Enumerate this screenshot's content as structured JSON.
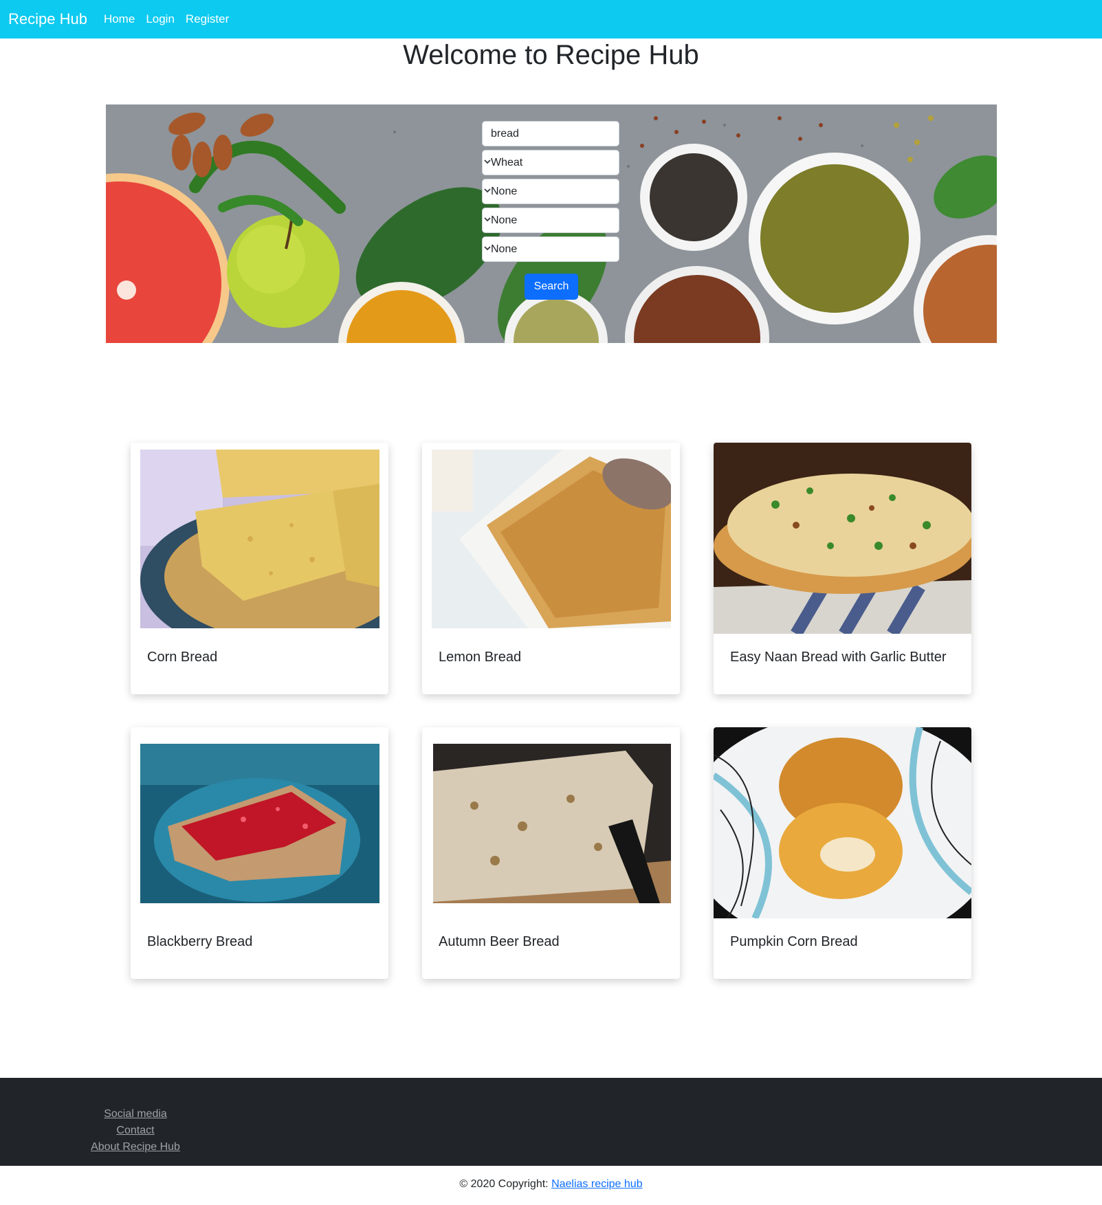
{
  "navbar": {
    "brand": "Recipe Hub",
    "links": [
      "Home",
      "Login",
      "Register"
    ]
  },
  "page_title": "Welcome to Recipe Hub",
  "search": {
    "query_value": "bread",
    "selects": [
      "Wheat",
      "None",
      "None",
      "None"
    ],
    "button_label": "Search"
  },
  "recipes": [
    {
      "title": "Corn Bread"
    },
    {
      "title": "Lemon Bread"
    },
    {
      "title": "Easy Naan Bread with Garlic Butter"
    },
    {
      "title": "Blackberry Bread"
    },
    {
      "title": "Autumn Beer Bread"
    },
    {
      "title": "Pumpkin Corn Bread"
    }
  ],
  "footer": {
    "links": [
      "Social media",
      "Contact",
      "About Recipe Hub"
    ],
    "copyright_prefix": "© 2020 Copyright:",
    "copyright_link": "Naelias recipe hub"
  },
  "colors": {
    "navbar": "#0dcaf0",
    "primary_button": "#0d6efd",
    "footer": "#212529"
  }
}
